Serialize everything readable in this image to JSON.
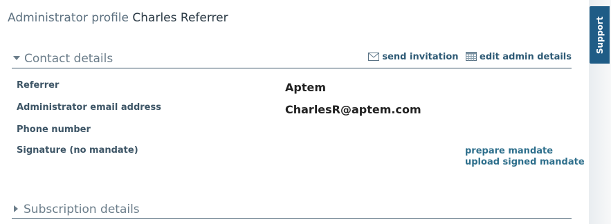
{
  "header": {
    "prefix": "Administrator profile",
    "name": "Charles Referrer"
  },
  "contact_section": {
    "title": "Contact details",
    "expanded": true,
    "actions": {
      "send_invitation": "send invitation",
      "edit_admin_details": "edit admin details",
      "send_icon": "envelope-icon",
      "edit_icon": "calendar-grid-icon"
    },
    "rows": [
      {
        "label": "Referrer",
        "value": "Aptem"
      },
      {
        "label": "Administrator email address",
        "value": "CharlesR@aptem.com"
      },
      {
        "label": "Phone number",
        "value": ""
      },
      {
        "label": "Signature (no mandate)",
        "value": ""
      }
    ],
    "mandate_links": {
      "prepare": "prepare mandate",
      "upload": "upload signed mandate"
    }
  },
  "subscription_section": {
    "title": "Subscription details",
    "expanded": false
  },
  "support_tab": {
    "label": "Support"
  },
  "colors": {
    "link": "#2e5a75",
    "support_tab": "#1f5c86",
    "section_rule": "#3a5568",
    "label": "#3d5566"
  }
}
